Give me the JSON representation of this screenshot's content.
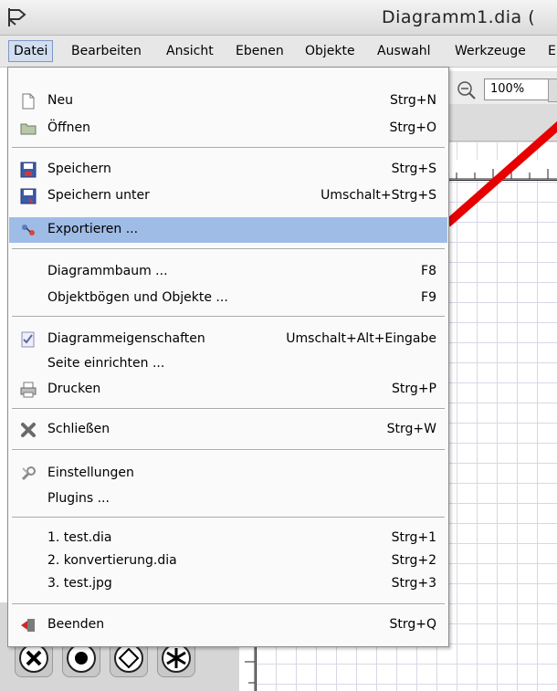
{
  "window": {
    "title": "Diagramm1.dia ("
  },
  "menubar": {
    "items": [
      "Datei",
      "Bearbeiten",
      "Ansicht",
      "Ebenen",
      "Objekte",
      "Auswahl",
      "Werkzeuge",
      "E"
    ]
  },
  "toolbar": {
    "zoom_value": "100%"
  },
  "menu": {
    "items": [
      {
        "label": "Neu",
        "shortcut": "Strg+N",
        "icon": "new-document-icon"
      },
      {
        "label": "Öffnen",
        "shortcut": "Strg+O",
        "icon": "folder-icon"
      },
      {
        "label": "Speichern",
        "shortcut": "Strg+S",
        "icon": "save-icon"
      },
      {
        "label": "Speichern unter",
        "shortcut": "Umschalt+Strg+S",
        "icon": "save-as-icon"
      },
      {
        "label": "Exportieren ...",
        "shortcut": "",
        "icon": "export-icon",
        "selected": true
      },
      {
        "label": "Diagrammbaum ...",
        "shortcut": "F8"
      },
      {
        "label": "Objektbögen und Objekte ...",
        "shortcut": "F9"
      },
      {
        "label": "Diagrammeigenschaften",
        "shortcut": "Umschalt+Alt+Eingabe",
        "icon": "properties-icon"
      },
      {
        "label": "Seite einrichten ...",
        "shortcut": ""
      },
      {
        "label": "Drucken",
        "shortcut": "Strg+P",
        "icon": "printer-icon"
      },
      {
        "label": "Schließen",
        "shortcut": "Strg+W",
        "icon": "close-icon"
      },
      {
        "label": "Einstellungen",
        "shortcut": "",
        "icon": "preferences-icon"
      },
      {
        "label": "Plugins ...",
        "shortcut": ""
      },
      {
        "label": "1. test.dia",
        "shortcut": "Strg+1"
      },
      {
        "label": "2. konvertierung.dia",
        "shortcut": "Strg+2"
      },
      {
        "label": "3. test.jpg",
        "shortcut": "Strg+3"
      },
      {
        "label": "Beenden",
        "shortcut": "Strg+Q",
        "icon": "quit-icon"
      }
    ]
  },
  "colors": {
    "selection": "#9fbce6",
    "arrow": "#e60000",
    "menu_bg": "#fafafa"
  }
}
